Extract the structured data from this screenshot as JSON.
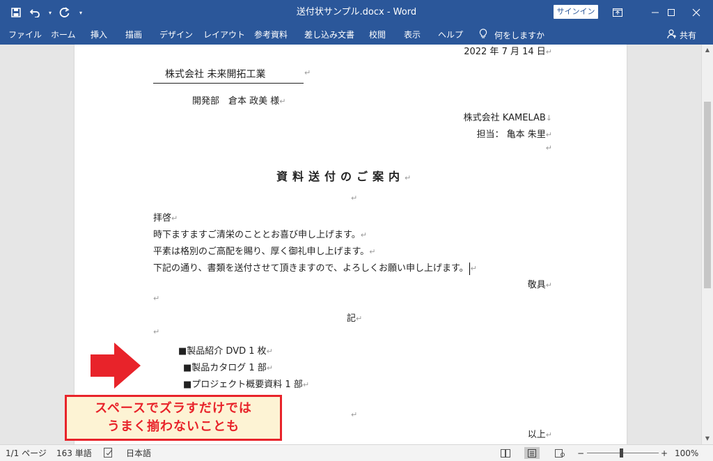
{
  "window": {
    "title": "送付状サンプル.docx  -  Word",
    "signin_label": "サインイン"
  },
  "ribbon": {
    "tabs": [
      "ファイル",
      "ホーム",
      "挿入",
      "描画",
      "デザイン",
      "レイアウト",
      "参考資料",
      "差し込み文書",
      "校閲",
      "表示",
      "ヘルプ"
    ],
    "tell_me": "何をしますか",
    "share": "共有"
  },
  "document": {
    "date": "2022 年 7 月 14 日",
    "recipient_company": "株式会社  未来開拓工業",
    "recipient_person": "開発部　倉本 政美  様",
    "sender_company": "株式会社 KAMELAB",
    "sender_contact": "担当：  亀本  朱里",
    "heading": "資料送付のご案内",
    "greeting": "拝啓",
    "body": [
      "時下ますますご清栄のこととお喜び申し上げます。",
      "平素は格別のご高配を賜り、厚く御礼申し上げます。",
      "下記の通り、書類を送付させて頂きますので、よろしくお願い申し上げます。"
    ],
    "closing": "敬具",
    "ki": "記",
    "items": [
      "■製品紹介 DVD 1 枚",
      "■製品カタログ  1 部",
      "■プロジェクト概要資料  1 部"
    ],
    "ijo": "以上",
    "para_mark": "↵",
    "line_break_mark": "↓"
  },
  "annotation": {
    "lines": [
      "スペースでズラすだけでは",
      "うまく揃わないことも"
    ],
    "color": "#e8232a"
  },
  "status": {
    "page": "1/1 ページ",
    "words": "163 単語",
    "language": "日本語",
    "zoom": "100%",
    "zoom_minus": "−",
    "zoom_plus": "+"
  },
  "colors": {
    "title_bar": "#2b579a",
    "accent": "#e8232a"
  }
}
